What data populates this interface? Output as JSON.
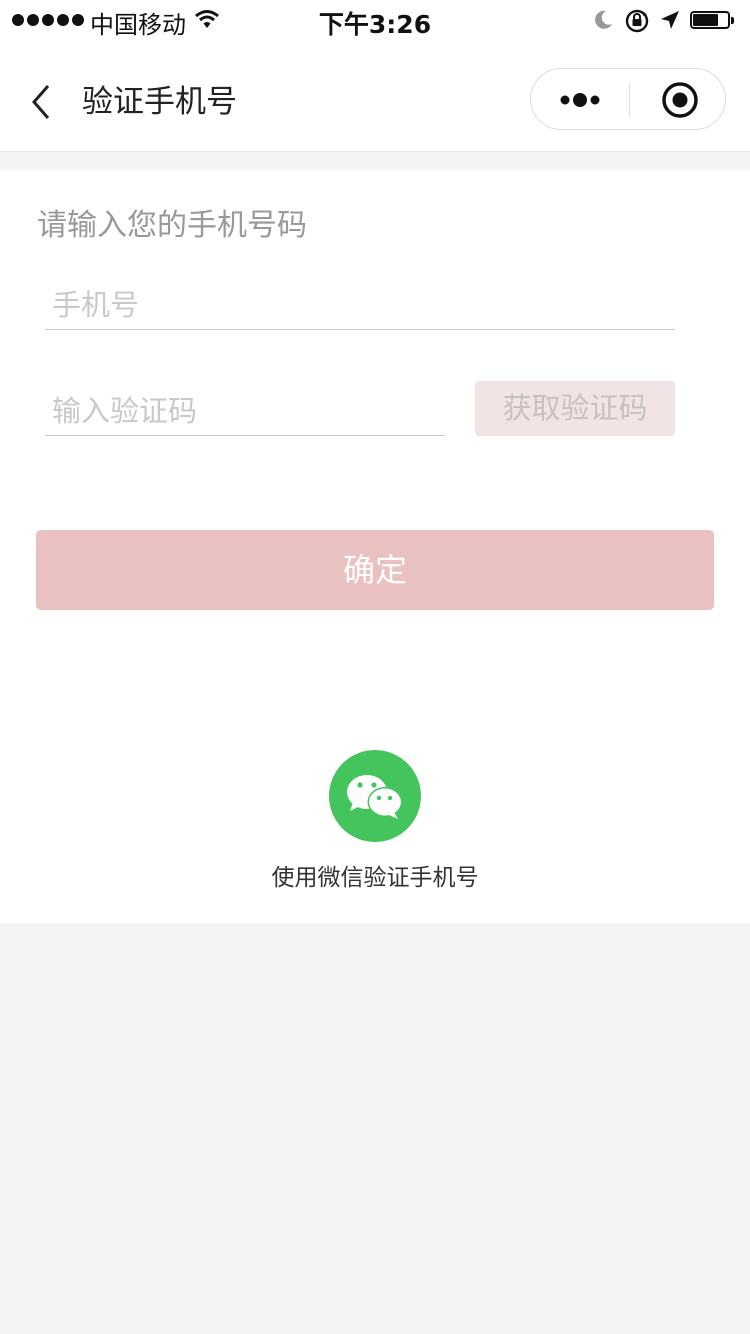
{
  "status_bar": {
    "carrier": "中国移动",
    "time": "下午3:26",
    "icons": [
      "signal-dots",
      "wifi-icon",
      "moon-icon",
      "rotation-lock-icon",
      "location-arrow-icon",
      "battery-icon"
    ]
  },
  "nav": {
    "title": "验证手机号",
    "icons": [
      "back-chevron-icon",
      "more-dots-icon",
      "close-target-icon"
    ]
  },
  "form": {
    "prompt": "请输入您的手机号码",
    "phone": {
      "value": "",
      "placeholder": "手机号"
    },
    "code": {
      "value": "",
      "placeholder": "输入验证码"
    },
    "get_code_label": "获取验证码",
    "confirm_label": "确定"
  },
  "wechat": {
    "icon": "wechat-icon",
    "label": "使用微信验证手机号"
  },
  "colors": {
    "accent_disabled": "#eac1c1",
    "get_code_bg": "#f2e4e5",
    "wechat_green": "#44c45c",
    "page_bg": "#f4f4f4"
  }
}
